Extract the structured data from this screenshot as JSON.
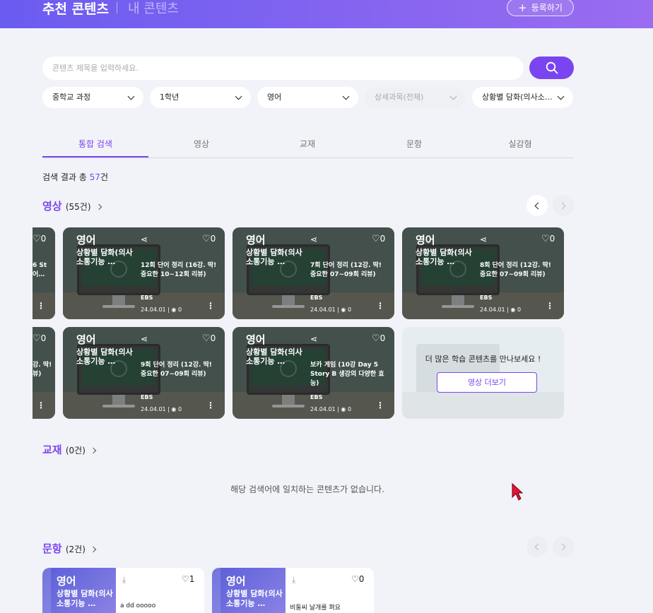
{
  "header": {
    "title": "추천 콘텐츠",
    "tab2": "내 콘텐츠",
    "register_label": "등록하기"
  },
  "search": {
    "placeholder": "콘텐츠 제목을 입력하세요."
  },
  "filters": [
    {
      "label": "중학교 과정",
      "disabled": false
    },
    {
      "label": "1학년",
      "disabled": false
    },
    {
      "label": "영어",
      "disabled": false
    },
    {
      "label": "상세과목(전체)",
      "disabled": true
    },
    {
      "label": "상황별 담화(의사소…",
      "disabled": false
    }
  ],
  "tabs": [
    "통합 검색",
    "영상",
    "교재",
    "문항",
    "실감형"
  ],
  "active_tab": "통합 검색",
  "result": {
    "prefix": "검색 결과 총 ",
    "count": "57",
    "suffix": "건"
  },
  "video_section": {
    "title": "영상",
    "count": "(55건)",
    "partial_cards": [
      {
        "like": "0",
        "title": "6 St\n어…"
      },
      {
        "like": "0",
        "title": "강. 딱!\n뷰)"
      }
    ],
    "cards": [
      {
        "subject": "영어",
        "course": "상황별 담화(의사소통기능 …",
        "like": "0",
        "title": "12회 단어 정리 (16강. 딱! 중요한 10~12회 리뷰)",
        "brand": "EBS",
        "date": "24.04.01 | ",
        "views": "0"
      },
      {
        "subject": "영어",
        "course": "상황별 담화(의사소통기능 …",
        "like": "0",
        "title": "7회 단어 정리 (12강. 딱! 중요한 07~09회 리뷰)",
        "brand": "EBS",
        "date": "24.04.01 | ",
        "views": "0"
      },
      {
        "subject": "영어",
        "course": "상황별 담화(의사소통기능 …",
        "like": "0",
        "title": "8회 단어 정리 (12강. 딱! 중요한 07~09회 리뷰)",
        "brand": "EBS",
        "date": "24.04.01 | ",
        "views": "0"
      },
      {
        "subject": "영어",
        "course": "상황별 담화(의사소통기능 …",
        "like": "0",
        "title": "9회 단어 정리 (12강. 딱! 중요한 07~09회 리뷰)",
        "brand": "EBS",
        "date": "24.04.01 | ",
        "views": "0"
      },
      {
        "subject": "영어",
        "course": "상황별 담화(의사소통기능 …",
        "like": "0",
        "title": "보카 게임 (10강 Day 5 Story B 생강의 다양한 효능)",
        "brand": "EBS",
        "date": "24.04.01 | ",
        "views": "0"
      }
    ],
    "more_card": {
      "message": "더 많은 학습 콘텐츠를 만나보세요 !",
      "button": "영상 더보기"
    }
  },
  "book_section": {
    "title": "교재",
    "count": "(0건)",
    "empty": "해당 검색어에 일치하는 콘텐츠가 없습니다."
  },
  "question_section": {
    "title": "문항",
    "count": "(2건)",
    "cards": [
      {
        "subject": "영어",
        "course": "상황별 담화(의사소통기능 …",
        "like": "1",
        "text": "a dd ooooo"
      },
      {
        "subject": "영어",
        "course": "상황별 담화(의사소통기능 …",
        "like": "0",
        "text": "비둘씨 날개를 펴요"
      }
    ]
  },
  "colors": {
    "accent": "#7a45f0",
    "header_start": "#6a5cf0",
    "header_end": "#9a6cf0",
    "background": "#f1f3f8"
  }
}
